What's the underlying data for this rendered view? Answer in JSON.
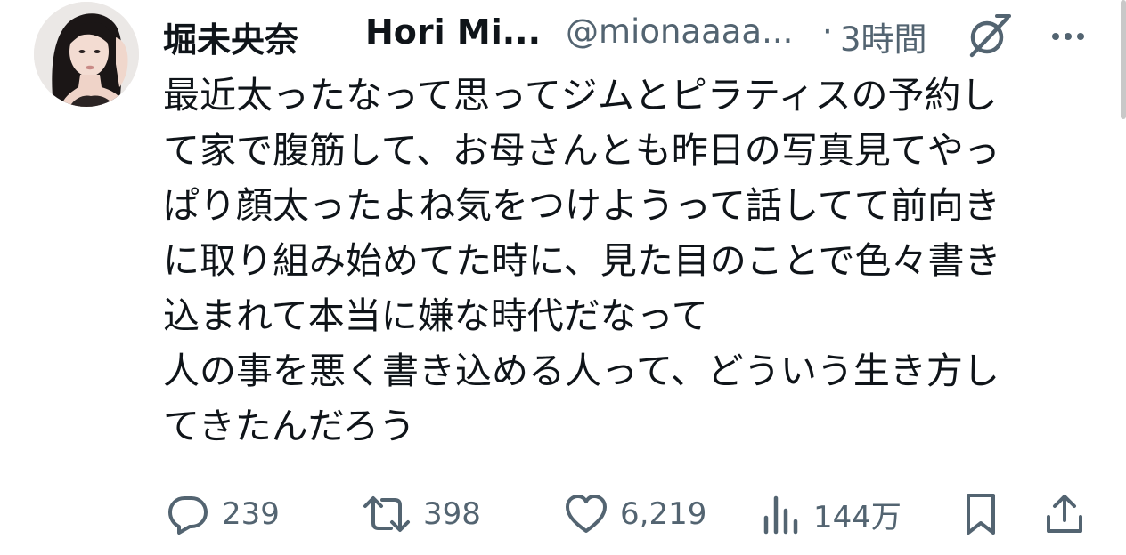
{
  "author": {
    "display_name": "堀未央奈",
    "display_name_latin": "Hori Mi...",
    "handle": "@mionaaaa...",
    "separator": "·",
    "time": "3時間"
  },
  "icons": {
    "grok": "grok-icon",
    "more": "more-icon",
    "reply": "reply-icon",
    "retweet": "retweet-icon",
    "like": "heart-icon",
    "views": "bar-chart-icon",
    "bookmark": "bookmark-icon",
    "share": "share-icon"
  },
  "tweet": {
    "lines": [
      "最近太ったなって思ってジムとピラティスの予約し",
      "て家で腹筋して、お母さんとも昨日の写真見てやっ",
      "ぱり顔太ったよね気をつけようって話してて前向き",
      "に取り組み始めてた時に、見た目のことで色々書き",
      "込まれて本当に嫌な時代だなって",
      "人の事を悪く書き込める人って、どういう生き方し",
      "てきたんだろう"
    ]
  },
  "stats": {
    "replies": "239",
    "retweets": "398",
    "likes": "6,219",
    "views": "144万"
  },
  "colors": {
    "text": "#0f1419",
    "secondary": "#536471"
  }
}
